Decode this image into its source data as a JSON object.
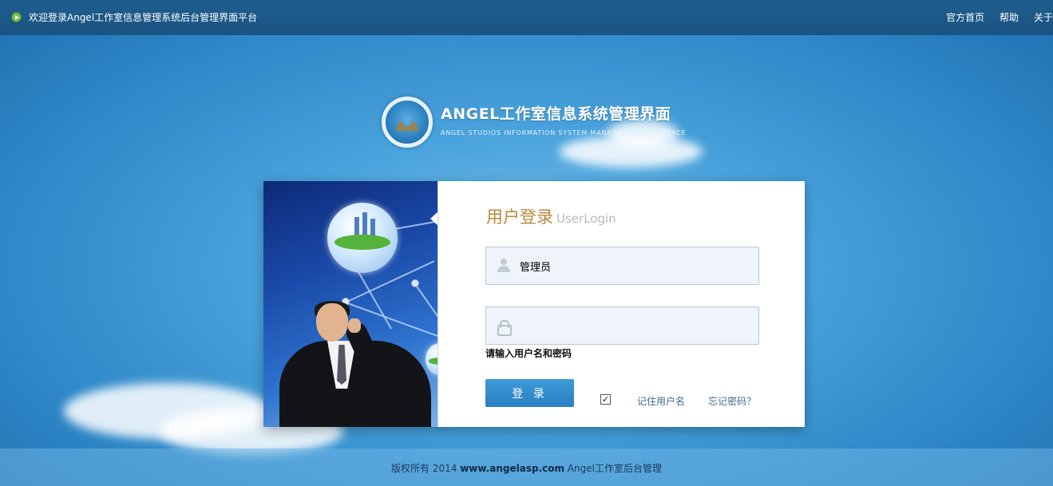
{
  "topbar": {
    "welcome": "欢迎登录Angel工作室信息管理系统后台管理界面平台",
    "nav": [
      "官方首页",
      "帮助",
      "关于"
    ]
  },
  "logo": {
    "title": "ANGEL工作室信息系统管理界面",
    "subtitle": "ANGEL STUDIOS INFORMATION SYSTEM MANAGEMENT INTERFACE"
  },
  "login": {
    "title_cn": "用户登录",
    "title_en": "UserLogin",
    "username_value": "管理员",
    "password_value": "",
    "hint": "请输入用户名和密码",
    "submit_label": "登 录",
    "remember_checked": true,
    "remember_mark": "✓",
    "remember_label": "记住用户名",
    "forgot_label": "忘记密码？"
  },
  "footer": {
    "prefix": "版权所有 2014 ",
    "site": "www.angelasp.com",
    "suffix": " Angel工作室后台管理"
  },
  "colors": {
    "topbar": "#1a5382",
    "accent_title": "#b8893e",
    "button": "#2a7fc0",
    "link": "#3d6b92"
  }
}
